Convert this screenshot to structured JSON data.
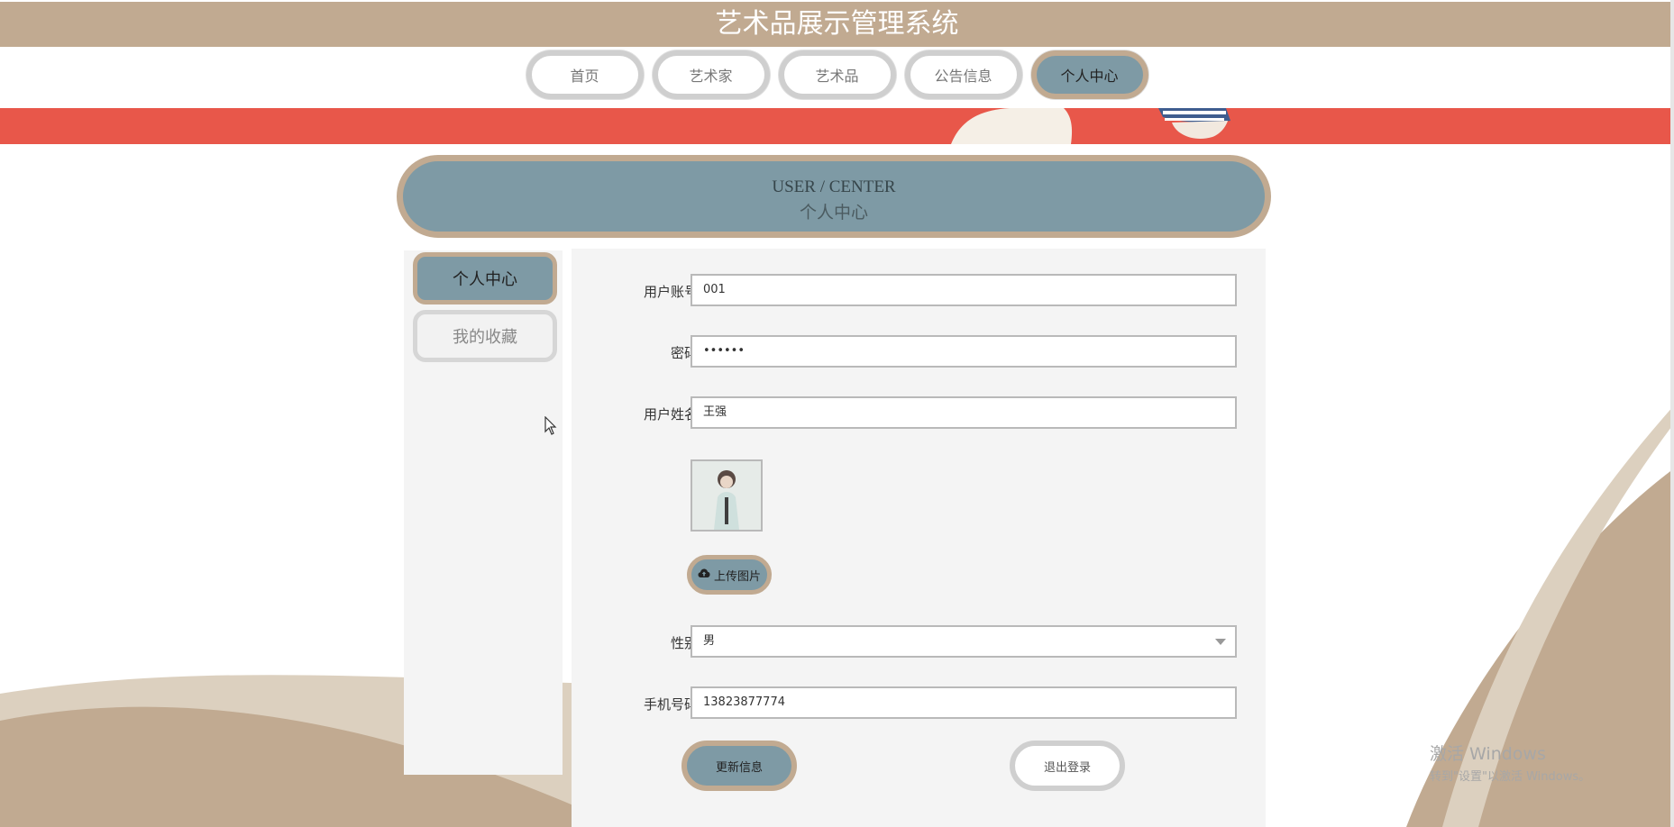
{
  "app": {
    "title": "艺术品展示管理系统"
  },
  "nav": {
    "items": [
      {
        "label": "首页"
      },
      {
        "label": "艺术家"
      },
      {
        "label": "艺术品"
      },
      {
        "label": "公告信息"
      },
      {
        "label": "个人中心",
        "active": true
      }
    ]
  },
  "header": {
    "en_title": "USER / CENTER",
    "zh_title": "个人中心"
  },
  "sidebar": {
    "items": [
      {
        "label": "个人中心",
        "active": true
      },
      {
        "label": "我的收藏"
      }
    ]
  },
  "form": {
    "account": {
      "label": "用户账号",
      "value": "001"
    },
    "password": {
      "label": "密码",
      "value": "••••••"
    },
    "name": {
      "label": "用户姓名",
      "value": "王强"
    },
    "upload_label": "上传图片",
    "gender": {
      "label": "性别",
      "value": "男"
    },
    "phone": {
      "label": "手机号码",
      "value": "13823877774"
    },
    "update_label": "更新信息",
    "logout_label": "退出登录"
  },
  "watermark": {
    "line1": "激活 Windows",
    "line2": "转到\"设置\"以激活 Windows。"
  },
  "colors": {
    "accent": "#7e9aa5",
    "border_tan": "#c1aa91",
    "banner_red": "#e8574a",
    "panel_bg": "#f4f4f4"
  },
  "icons": {
    "upload": "cloud-upload-icon",
    "select": "chevron-down-icon",
    "cursor": "mouse-cursor-icon"
  }
}
